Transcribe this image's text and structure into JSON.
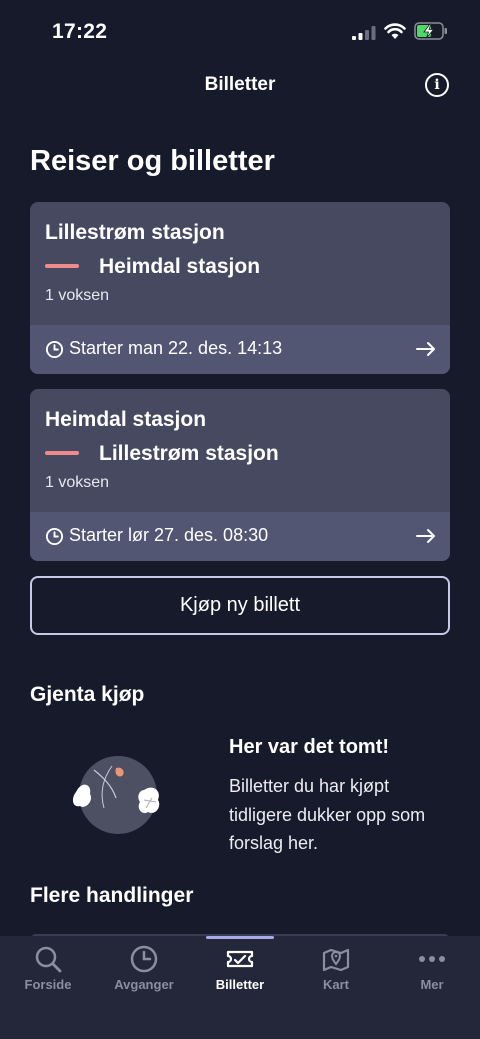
{
  "status_bar": {
    "time": "17:22"
  },
  "header": {
    "title": "Billetter",
    "info_icon": "info-icon"
  },
  "page_title": "Reiser og billetter",
  "trips": [
    {
      "from": "Lillestrøm stasjon",
      "to": "Heimdal stasjon",
      "passengers": "1 voksen",
      "start": "Starter man 22. des. 14:13"
    },
    {
      "from": "Heimdal stasjon",
      "to": "Lillestrøm stasjon",
      "passengers": "1 voksen",
      "start": "Starter lør 27. des. 08:30"
    }
  ],
  "buy_button": {
    "label": "Kjøp ny billett"
  },
  "repeat_section": {
    "title": "Gjenta kjøp",
    "empty_title": "Her var det tomt!",
    "empty_body": "Billetter du har kjøpt tidligere dukker opp som forslag her."
  },
  "more_section": {
    "title": "Flere handlinger"
  },
  "tabs": [
    {
      "label": "Forside",
      "icon": "search-icon",
      "active": false
    },
    {
      "label": "Avganger",
      "icon": "clock-icon",
      "active": false
    },
    {
      "label": "Billetter",
      "icon": "ticket-icon",
      "active": true
    },
    {
      "label": "Kart",
      "icon": "map-pin-icon",
      "active": false
    },
    {
      "label": "Mer",
      "icon": "more-icon",
      "active": false
    }
  ],
  "colors": {
    "background": "#171a2b",
    "card": "#474960",
    "card_footer": "#535673",
    "line_accent": "#f08b8b",
    "tab_bar": "#24263a",
    "tab_indicator": "#a8a9e6"
  }
}
